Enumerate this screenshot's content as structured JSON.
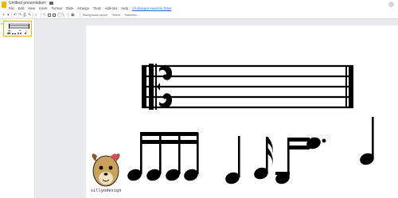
{
  "app": {
    "doc_title": "Untitled presentation",
    "last_edit": "All changes saved in Drive"
  },
  "menu": [
    "File",
    "Edit",
    "View",
    "Insert",
    "Format",
    "Slide",
    "Arrange",
    "Tools",
    "Add-ons",
    "Help"
  ],
  "toolbar": {
    "background_label": "Background...",
    "layout_label": "Layout",
    "theme_label": "Theme...",
    "transition_label": "Transition..."
  },
  "filmstrip": {
    "slide_number": "1"
  },
  "slide": {
    "staff": {
      "clef": "alto-clef",
      "barline": "final"
    },
    "notes": [
      "four-sixteenth-notes-beamed",
      "quarter-note",
      "dotted-eighth-sixteenth",
      "quarter-note"
    ],
    "credit": "sillyodesign",
    "colors": {
      "ink": "#000000",
      "mascot": "#c9a15a",
      "mascot_dark": "#8b5a2b",
      "bow": "#d94a5a"
    }
  }
}
